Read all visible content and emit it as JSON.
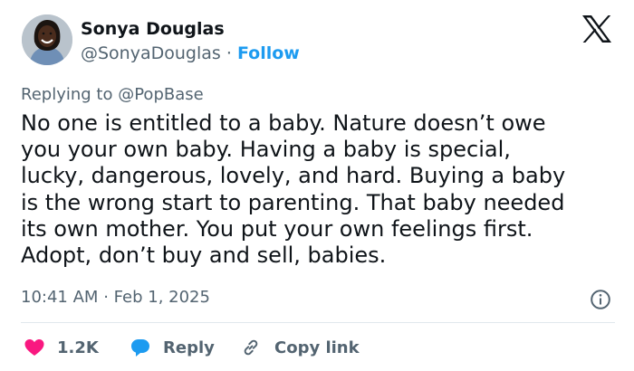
{
  "author": {
    "name": "Sonya Douglas",
    "handle": "@SonyaDouglas",
    "separator": "·",
    "follow_label": "Follow"
  },
  "brand": {
    "icon": "x-logo-icon"
  },
  "tweet": {
    "reply_prefix": "Replying to",
    "reply_handle": "@PopBase",
    "lines": [
      "No one is entitled to a baby. Nature doesn’t owe",
      "you your own baby. Having a baby is special,",
      "lucky, dangerous, lovely, and hard. Buying a baby",
      "is the wrong start to parenting. That baby needed",
      "its own mother. You put your own feelings first.",
      "Adopt, don’t buy and sell, babies."
    ],
    "time": "10:41 AM",
    "date_separator": "·",
    "date": "Feb 1, 2025"
  },
  "actions": {
    "like_count": "1.2K",
    "reply_label": "Reply",
    "copy_link_label": "Copy link"
  },
  "colors": {
    "accent": "#1d9bf0",
    "like": "#f91880",
    "text": "#0f1419",
    "muted": "#536471"
  }
}
